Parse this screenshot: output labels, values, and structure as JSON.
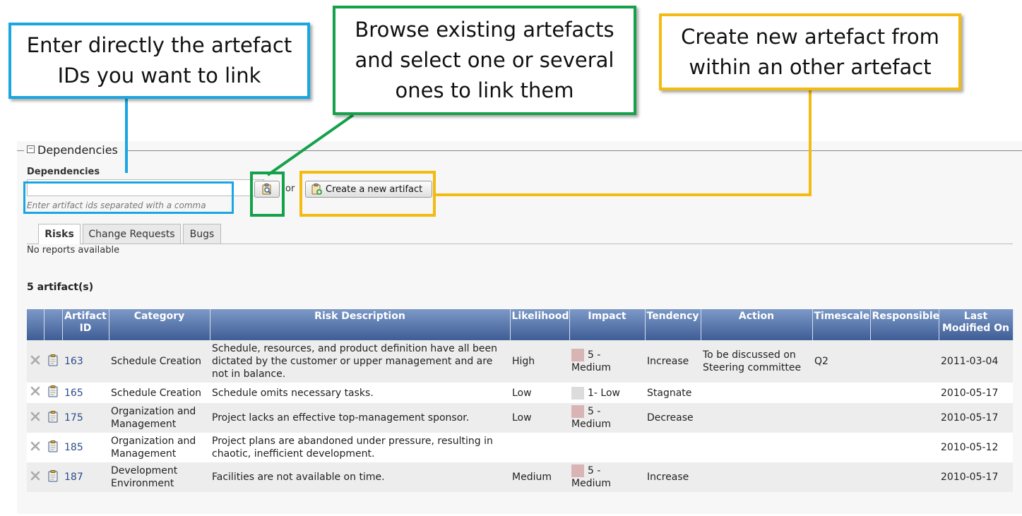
{
  "colors": {
    "blue": "#1aa6e0",
    "green": "#15a14a",
    "yellow": "#f3bb10",
    "header_start": "#7c99c7",
    "header_end": "#3f5d96",
    "medium_swatch": "#d9b4b4",
    "low_swatch": "#dcdcdc"
  },
  "callouts": {
    "blue": {
      "text": "Enter directly the artefact IDs you want to link"
    },
    "green": {
      "text": "Browse existing artefacts and select one or several ones to link them"
    },
    "yellow": {
      "text": "Create new artefact from within an other artefact"
    }
  },
  "section": {
    "legend": "Dependencies"
  },
  "dependencies": {
    "label": "Dependencies",
    "input_value": "",
    "hint": "Enter artifact ids separated with a comma",
    "browse_icon": "clipboard-search-icon",
    "or_text": "or",
    "create_label": "Create a new artifact",
    "create_icon": "clipboard-add-icon"
  },
  "tabs": [
    {
      "label": "Risks",
      "active": true
    },
    {
      "label": "Change Requests",
      "active": false
    },
    {
      "label": "Bugs",
      "active": false
    }
  ],
  "no_reports": "No reports available",
  "count_label": "5 artifact(s)",
  "table": {
    "columns": [
      "",
      "",
      "Artifact ID",
      "Category",
      "Risk Description",
      "Likelihood",
      "Impact",
      "Tendency",
      "Action",
      "Timescale",
      "Responsible",
      "Last Modified On"
    ],
    "rows": [
      {
        "id": "163",
        "category": "Schedule Creation",
        "description": "Schedule, resources, and product definition have all been dictated by the customer or upper management and are not in balance.",
        "likelihood": "High",
        "impact": "5 - Medium",
        "impact_level": "medium",
        "tendency": "Increase",
        "action": "To be discussed on Steering committee",
        "timescale": "Q2",
        "responsible": "",
        "modified": "2011-03-04"
      },
      {
        "id": "165",
        "category": "Schedule Creation",
        "description": "Schedule omits necessary tasks.",
        "likelihood": "Low",
        "impact": "1- Low",
        "impact_level": "low",
        "tendency": "Stagnate",
        "action": "",
        "timescale": "",
        "responsible": "",
        "modified": "2010-05-17"
      },
      {
        "id": "175",
        "category": "Organization and Management",
        "description": "Project lacks an effective top-management sponsor.",
        "likelihood": "Low",
        "impact": "5 - Medium",
        "impact_level": "medium",
        "tendency": "Decrease",
        "action": "",
        "timescale": "",
        "responsible": "",
        "modified": "2010-05-17"
      },
      {
        "id": "185",
        "category": "Organization and Management",
        "description": "Project plans are abandoned under pressure, resulting in chaotic, inefficient development.",
        "likelihood": "",
        "impact": "",
        "impact_level": "",
        "tendency": "",
        "action": "",
        "timescale": "",
        "responsible": "",
        "modified": "2010-05-12"
      },
      {
        "id": "187",
        "category": "Development Environment",
        "description": "Facilities are not available on time.",
        "likelihood": "Medium",
        "impact": "5 - Medium",
        "impact_level": "medium",
        "tendency": "Increase",
        "action": "",
        "timescale": "",
        "responsible": "",
        "modified": "2010-05-17"
      }
    ],
    "row_icons": {
      "remove": "remove-x-icon",
      "artifact": "artifact-clipboard-icon"
    }
  }
}
